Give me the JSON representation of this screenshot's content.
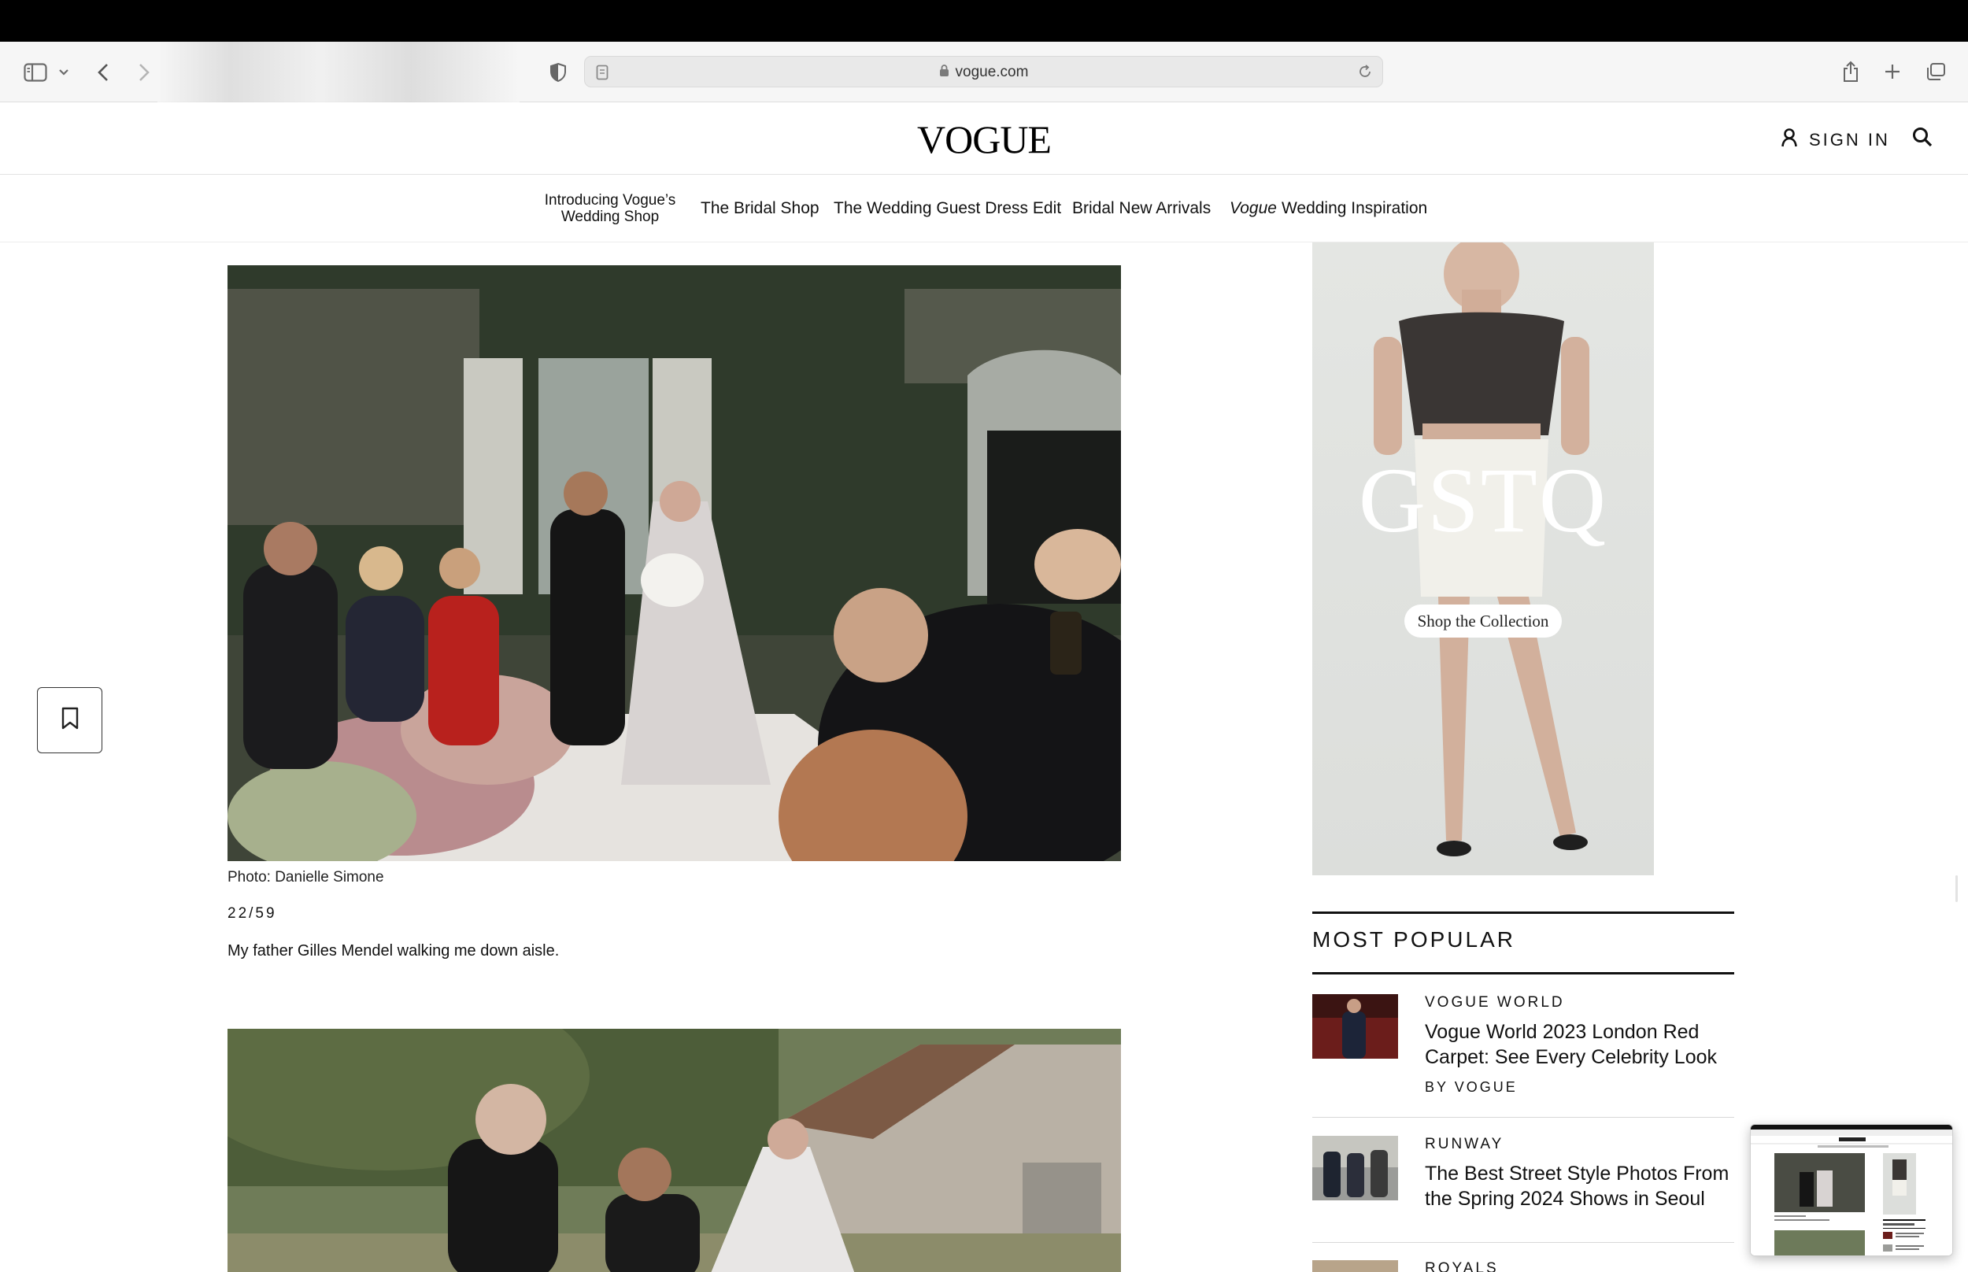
{
  "browser": {
    "url": "vogue.com"
  },
  "header": {
    "logo": "VOGUE",
    "signin_label": "SIGN IN"
  },
  "nav": {
    "items": [
      "Introducing Vogue’s Wedding Shop",
      "The Bridal Shop",
      "The Wedding Guest Dress Edit",
      "Bridal New Arrivals",
      "Wedding Inspiration"
    ],
    "last_item_prefix": "Vogue"
  },
  "article": {
    "photo_credit": "Photo: Danielle Simone",
    "counter": "22/59",
    "caption": "My father Gilles Mendel walking me down aisle."
  },
  "ad": {
    "brand": "GSTQ",
    "cta": "Shop the Collection"
  },
  "most_popular": {
    "title": "MOST POPULAR",
    "items": [
      {
        "category": "VOGUE WORLD",
        "headline": "Vogue World 2023 London Red Carpet: See Every Celebrity Look",
        "byline": "BY VOGUE"
      },
      {
        "category": "RUNWAY",
        "headline": "The Best Street Style Photos From the Spring 2024 Shows in Seoul"
      },
      {
        "category": "ROYALS"
      }
    ]
  },
  "colors": {
    "menubar": "#000000",
    "toolbar": "#f6f6f6",
    "text": "#111111",
    "ad_background": "#e2e4e1"
  }
}
